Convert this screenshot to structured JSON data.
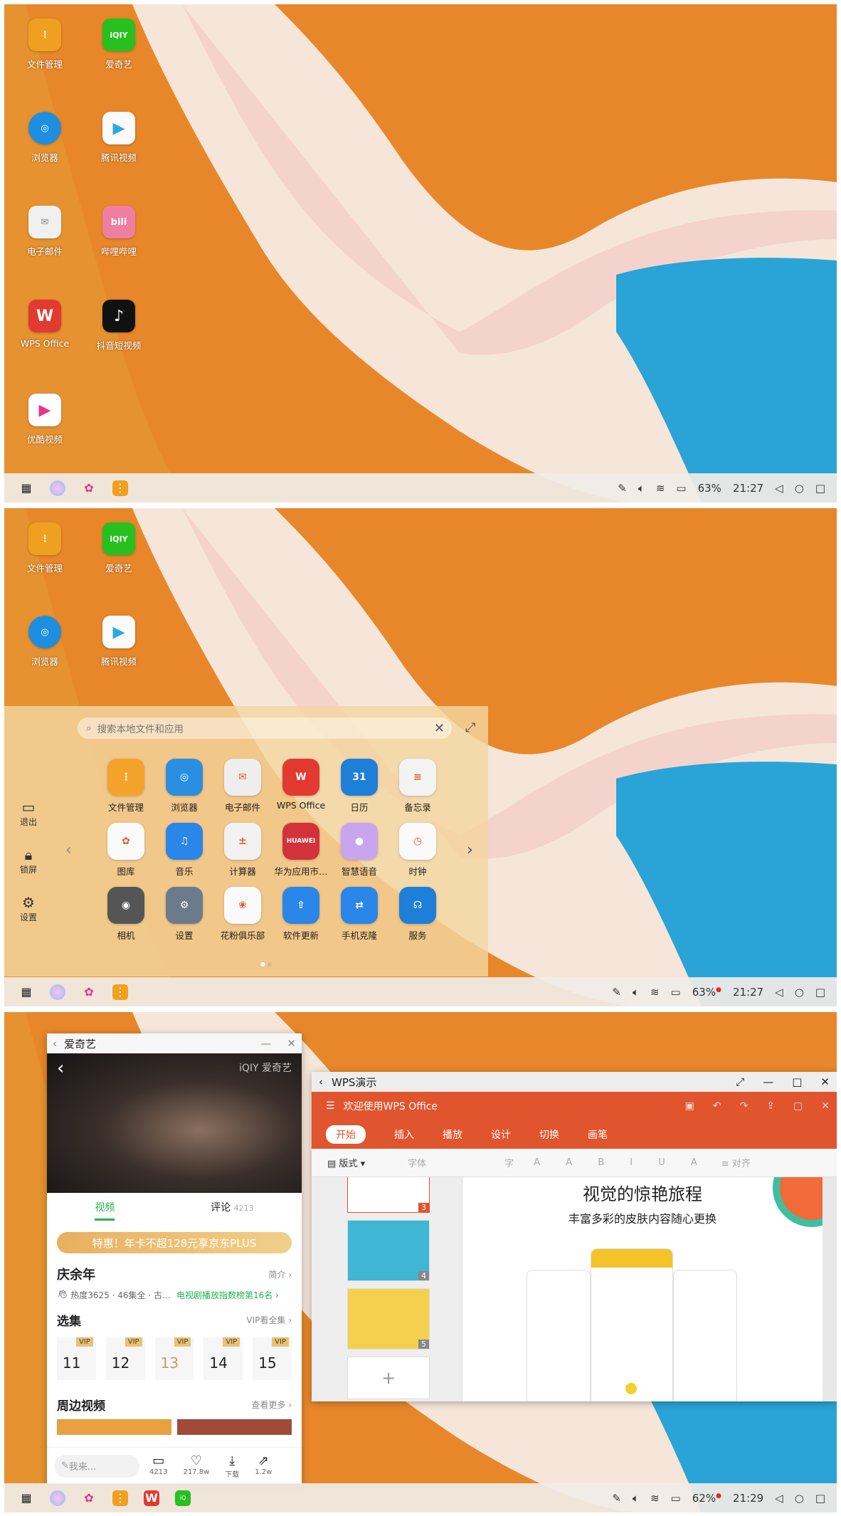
{
  "wallpaper": {
    "orange": "#e8872a",
    "cream": "#f7e6d8",
    "pink": "#f0c4c2",
    "blue": "#2aa4d6"
  },
  "screen1": {
    "desktop_apps": [
      {
        "label": "文件管理",
        "icon": "folder-icon",
        "color": "#f0a020"
      },
      {
        "label": "爱奇艺",
        "icon": "iqiyi-icon",
        "color": "#27c01f",
        "text": "iQIY"
      },
      {
        "label": "浏览器",
        "icon": "browser-icon",
        "color": "#1e8ee0"
      },
      {
        "label": "腾讯视频",
        "icon": "tencent-video-icon",
        "color": "#fafafa"
      },
      {
        "label": "电子邮件",
        "icon": "mail-icon",
        "color": "#f0f0f0"
      },
      {
        "label": "哔哩哔哩",
        "icon": "bilibili-icon",
        "color": "#f07ea0",
        "text": "bili"
      },
      {
        "label": "WPS Office",
        "icon": "wps-icon",
        "color": "#e23a30",
        "text": "W"
      },
      {
        "label": "抖音短视频",
        "icon": "douyin-icon",
        "color": "#111111",
        "text": "♪"
      },
      {
        "label": "优酷视频",
        "icon": "youku-icon",
        "color": "#ffffff",
        "text": "▶"
      }
    ],
    "status": {
      "battery": "63%",
      "time": "21:27"
    }
  },
  "screen2": {
    "desktop_apps": [
      {
        "label": "文件管理",
        "icon": "folder-icon",
        "color": "#f0a020"
      },
      {
        "label": "爱奇艺",
        "icon": "iqiyi-icon",
        "color": "#27c01f",
        "text": "iQIY"
      },
      {
        "label": "浏览器",
        "icon": "browser-icon",
        "color": "#1e8ee0"
      },
      {
        "label": "腾讯视频",
        "icon": "tencent-video-icon",
        "color": "#fafafa"
      }
    ],
    "search_placeholder": "搜索本地文件和应用",
    "side": [
      {
        "label": "退出",
        "icon": "laptop-icon"
      },
      {
        "label": "锁屏",
        "icon": "lock-icon"
      },
      {
        "label": "设置",
        "icon": "gear-icon"
      }
    ],
    "apps": [
      {
        "label": "文件管理",
        "icon": "folder-icon",
        "color": "#f3a32a",
        "text": "⋮"
      },
      {
        "label": "浏览器",
        "icon": "browser-icon",
        "color": "#2a8fe0",
        "text": "◎"
      },
      {
        "label": "电子邮件",
        "icon": "mail-icon",
        "color": "#eeeeee",
        "text": "✉"
      },
      {
        "label": "WPS Office",
        "icon": "wps-icon",
        "color": "#e23a30",
        "text": "W"
      },
      {
        "label": "日历",
        "icon": "calendar-icon",
        "color": "#1e7fd8",
        "text": "31"
      },
      {
        "label": "备忘录",
        "icon": "notes-icon",
        "color": "#f3f3f3",
        "text": "≡"
      },
      {
        "label": "图库",
        "icon": "gallery-icon",
        "color": "#fafafa",
        "text": "✿"
      },
      {
        "label": "音乐",
        "icon": "music-icon",
        "color": "#2a86e8",
        "text": "♫"
      },
      {
        "label": "计算器",
        "icon": "calculator-icon",
        "color": "#f2f2f2",
        "text": "±"
      },
      {
        "label": "华为应用市…",
        "icon": "appgallery-icon",
        "color": "#d4323a",
        "text": "HUAWEI"
      },
      {
        "label": "智慧语音",
        "icon": "voice-assistant-icon",
        "color": "#c9a5f0",
        "text": "●"
      },
      {
        "label": "时钟",
        "icon": "clock-icon",
        "color": "#fafafa",
        "text": "◷"
      },
      {
        "label": "相机",
        "icon": "camera-icon",
        "color": "#555555",
        "text": "◉"
      },
      {
        "label": "设置",
        "icon": "settings-icon",
        "color": "#6b7b8c",
        "text": "⚙"
      },
      {
        "label": "花粉俱乐部",
        "icon": "club-icon",
        "color": "#fafafa",
        "text": "❀"
      },
      {
        "label": "软件更新",
        "icon": "update-icon",
        "color": "#2a86e8",
        "text": "⇧"
      },
      {
        "label": "手机克隆",
        "icon": "phone-clone-icon",
        "color": "#2a86e8",
        "text": "⇄"
      },
      {
        "label": "服务",
        "icon": "service-icon",
        "color": "#1e7fd8",
        "text": "☊"
      }
    ],
    "status": {
      "battery": "63%",
      "time": "21:27"
    }
  },
  "screen3": {
    "iqiyi": {
      "window_title": "爱奇艺",
      "logo": "iQIY 爱奇艺",
      "tab_video": "视频",
      "tab_comment": "评论",
      "comment_count": "4213",
      "promo": "特惠！年卡不超128元享京东PLUS",
      "show_title": "庆余年",
      "intro": "简介",
      "heat": "热度3625 · 46集全 · 古…",
      "rank": "电视剧播放指数榜第16名",
      "episodes_label": "选集",
      "vip_all": "VIP看全集",
      "episodes": [
        "11",
        "12",
        "13",
        "14",
        "15"
      ],
      "vip_tag": "VIP",
      "related": "周边视频",
      "more": "查看更多",
      "comment_placeholder": "我来...",
      "actions": [
        {
          "icon": "comment-icon",
          "label": "4213"
        },
        {
          "icon": "heart-icon",
          "label": "217.8w"
        },
        {
          "icon": "download-icon",
          "label": "下载"
        },
        {
          "icon": "share-icon",
          "label": "1.2w"
        }
      ]
    },
    "wps": {
      "window_title": "WPS演示",
      "header": "欢迎使用WPS Office",
      "tabs": [
        "开始",
        "插入",
        "播放",
        "设计",
        "切换",
        "画笔"
      ],
      "layout_btn": "版式",
      "font_label": "字体",
      "font_size_label": "字",
      "align_label": "对齐",
      "slide_title": "视觉的惊艳旅程",
      "slide_subtitle": "丰富多彩的皮肤内容随心更换",
      "thumb_numbers": [
        "3",
        "4",
        "5"
      ]
    },
    "status": {
      "battery": "62%",
      "time": "21:29"
    }
  }
}
